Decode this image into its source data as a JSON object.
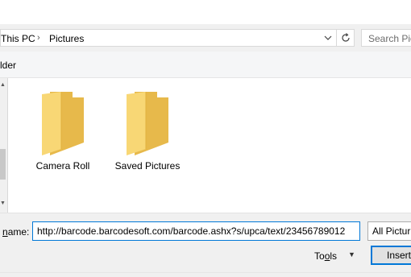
{
  "address_bar": {
    "crumbs": [
      "This PC",
      "Pictures"
    ],
    "separator": "›",
    "dropdown_icon": "chevron-down-icon",
    "refresh_icon": "refresh-icon"
  },
  "search": {
    "placeholder": "Search Pic"
  },
  "command_bar": {
    "new_folder_label": "lder"
  },
  "nav_pane": {
    "scroll_up": "▲",
    "scroll_down": "▼"
  },
  "folders": [
    {
      "name": "Camera Roll"
    },
    {
      "name": "Saved Pictures"
    }
  ],
  "file_name": {
    "label": "name:",
    "label_underlined_char": "n",
    "label_rest": "ame:",
    "value": "http://barcode.barcodesoft.com/barcode.ashx?s/upca/text/23456789012"
  },
  "file_type": {
    "selected": "All Pictur"
  },
  "tools": {
    "label": "Tools",
    "underlined_char": "l",
    "caret": "▼"
  },
  "insert_button": {
    "label": "Insert"
  },
  "colors": {
    "accent": "#0078d7",
    "folder_front": "#f8d775",
    "folder_back": "#e7b94b"
  }
}
